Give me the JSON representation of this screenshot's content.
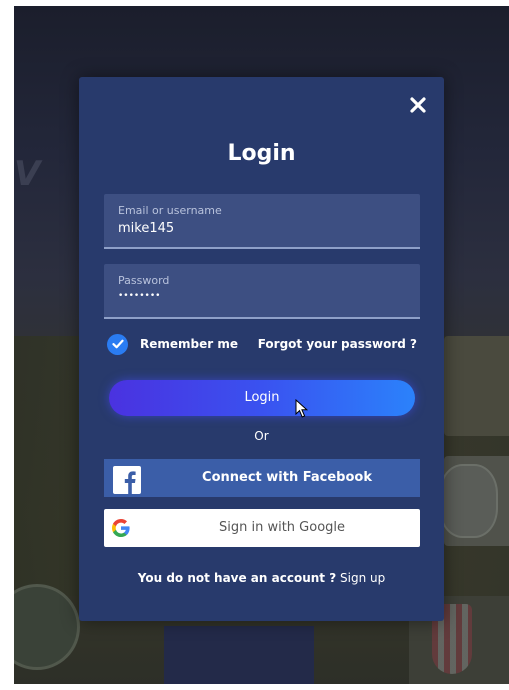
{
  "modal": {
    "title": "Login",
    "close_icon": "close-icon",
    "email_field": {
      "label": "Email or username",
      "value": "mike145"
    },
    "password_field": {
      "label": "Password",
      "value": "••••••••"
    },
    "remember": {
      "label": "Remember me",
      "checked": true
    },
    "forgot_link": "Forgot your password ?",
    "login_button": "Login",
    "or_text": "Or",
    "facebook_button": "Connect with Facebook",
    "google_button": "Sign in with Google",
    "signup_prompt": "You do not have an account ?",
    "signup_link": "Sign up"
  },
  "colors": {
    "modal_bg": "#283a6c",
    "field_bg": "#3d4f82",
    "login_gradient_start": "#4a32e0",
    "login_gradient_end": "#2b82fb",
    "facebook_blue": "#3b5ea8",
    "checkbox_blue": "#2a7cf2"
  }
}
